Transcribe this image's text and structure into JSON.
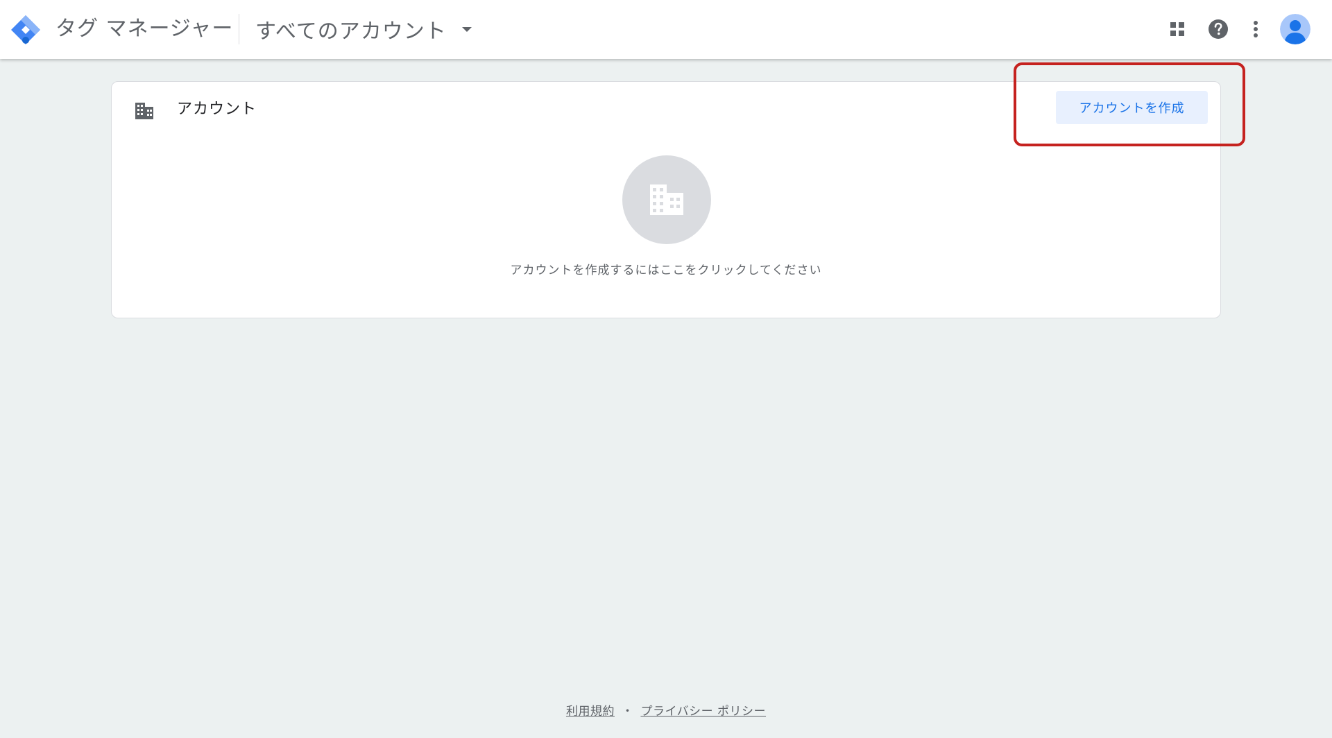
{
  "header": {
    "app_title": "タグ マネージャー",
    "account_selector_label": "すべてのアカウント",
    "icons": {
      "apps": "apps-grid-icon",
      "help": "help-icon",
      "more": "more-vert-icon",
      "avatar": "account-avatar-icon"
    }
  },
  "card": {
    "title": "アカウント",
    "create_button_label": "アカウントを作成",
    "empty_message": "アカウントを作成するにはここをクリックしてください",
    "icons": {
      "header": "building-icon",
      "empty": "building-icon"
    }
  },
  "footer": {
    "terms_label": "利用規約",
    "separator": "・",
    "privacy_label": "プライバシー ポリシー"
  },
  "colors": {
    "background": "#ecf1f1",
    "accent": "#1a73e8",
    "button_bg": "#e8f0fe",
    "highlight": "#c5221f"
  }
}
